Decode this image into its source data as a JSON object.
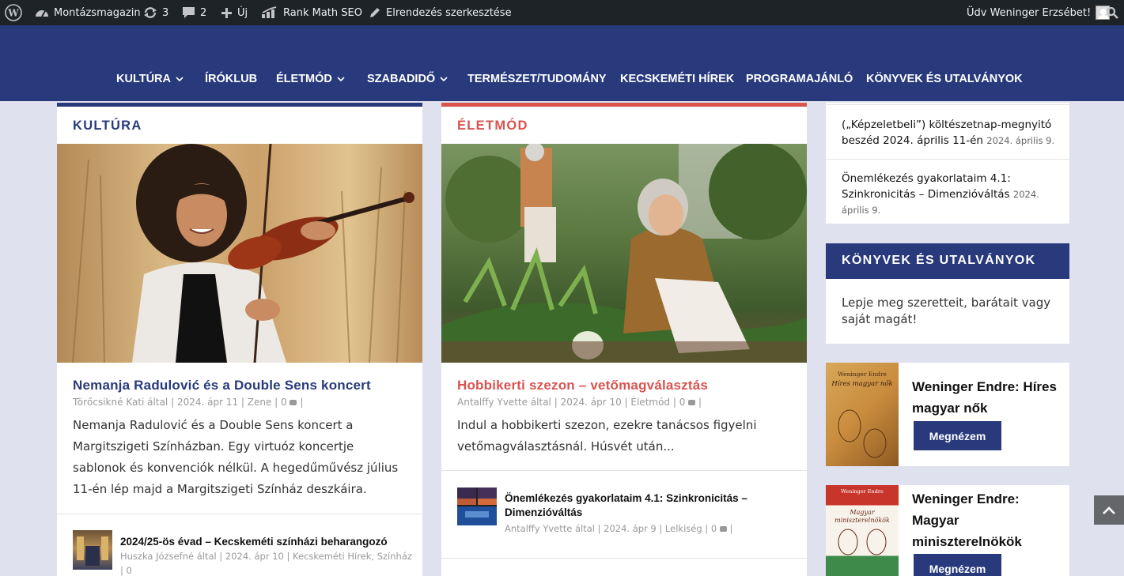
{
  "admin_bar": {
    "site_name": "Montázsmagazin",
    "updates_count": "3",
    "comments_count": "2",
    "new_label": "Új",
    "seo_label": "Rank Math SEO",
    "edit_layout_label": "Elrendezés szerkesztése",
    "greeting": "Üdv Weninger Erzsébet!"
  },
  "nav": {
    "items": [
      {
        "label": "KULTÚRA",
        "dropdown": true
      },
      {
        "label": "ÍRÓKLUB",
        "dropdown": false
      },
      {
        "label": "ÉLETMÓD",
        "dropdown": true
      },
      {
        "label": "SZABADIDŐ",
        "dropdown": true
      },
      {
        "label": "TERMÉSZET/TUDOMÁNY",
        "dropdown": false
      },
      {
        "label": "KECSKEMÉTI HÍREK",
        "dropdown": false
      },
      {
        "label": "PROGRAMAJÁNLÓ",
        "dropdown": false
      },
      {
        "label": "KÖNYVEK ÉS UTALVÁNYOK",
        "dropdown": false
      }
    ]
  },
  "kultura": {
    "heading": "KULTÚRA",
    "accent": "#283a7c",
    "main": {
      "title": "Nemanja Radulović és a Double Sens koncert",
      "meta": "Törőcsikné Kati által | 2024. ápr 11 | Zene | 0",
      "excerpt": "Nemanja Radulović és a Double Sens koncert a Margitszigeti Színházban. Egy virtuóz koncertje sablonok és konvenciók nélkül. A hegedűművész július 11-én lép majd a Margitszigeti Színház deszkáira."
    },
    "small": {
      "title": "2024/25-ös évad – Kecskeméti színházi beharangozó",
      "meta1": "Huszka Józsefné által | 2024. ápr 10 | Kecskeméti Hírek, Színház",
      "meta2": "| 0"
    }
  },
  "eletmod": {
    "heading": "ÉLETMÓD",
    "accent": "#d9534f",
    "main": {
      "title": "Hobbikerti szezon – vetőmagválasztás",
      "meta": "Antalffy Yvette által | 2024. ápr 10 | Életmód | 0",
      "excerpt": "Indul a hobbikerti szezon, ezekre tanácsos figyelni vetőmagválasztásnál. Húsvét után..."
    },
    "small": {
      "title": "Önemlékezés gyakorlataim 4.1: Szinkronicitás – Dimenzióváltás",
      "meta": "Antalffy Yvette által | 2024. ápr 9 | Lelkiség | 0"
    }
  },
  "sidebar": {
    "recent": [
      {
        "title": "(„Képzeletbeli”) költészetnap-megnyitó beszéd 2024. április 11-én",
        "date": "2024. április 9."
      },
      {
        "title": "Önemlékezés gyakorlataim 4.1: Szinkronicitás – Dimenzióváltás",
        "date": "2024. április 9."
      }
    ],
    "books_widget": {
      "heading": "KÖNYVEK ÉS UTALVÁNYOK",
      "text": "Lepje meg szeretteit, barátait vagy saját magát!"
    },
    "book1": {
      "title": "Weninger Endre: Híres magyar nők",
      "cover_author": "Weninger Endre",
      "cover_title": "Híres magyar nők",
      "button": "Megnézem"
    },
    "book2": {
      "title": "Weninger Endre: Magyar miniszterelnökök",
      "cover_author": "Weninger Endre",
      "cover_title": "Magyar miniszterelnökök",
      "button": "Megnézem"
    }
  },
  "colors": {
    "brand": "#283a7c",
    "accent_red": "#d9534f",
    "admin_bar": "#1d2327"
  }
}
